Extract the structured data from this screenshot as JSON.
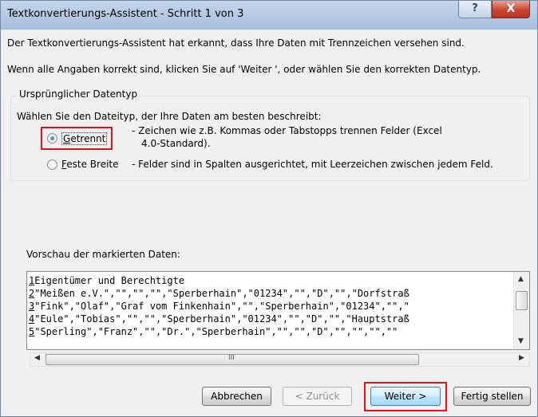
{
  "window": {
    "title": "Textkonvertierungs-Assistent - Schritt 1 von 3",
    "help_label": "?",
    "close_label": "X"
  },
  "info": {
    "line1": "Der Textkonvertierungs-Assistent hat erkannt, dass Ihre Daten mit Trennzeichen versehen sind.",
    "line2": "Wenn alle Angaben korrekt sind, klicken Sie auf 'Weiter ', oder wählen Sie den korrekten Datentyp."
  },
  "datatype_group": {
    "legend": "Ursprünglicher Datentyp",
    "prompt": "Wählen Sie den Dateityp, der Ihre Daten am besten beschreibt:",
    "options": [
      {
        "label": "Getrennt",
        "selected": true,
        "description_line1": "- Zeichen wie z.B. Kommas oder Tabstopps trennen Felder (Excel",
        "description_line2": "4.0-Standard)."
      },
      {
        "label": "Feste Breite",
        "selected": false,
        "description_line1": "- Felder sind in Spalten ausgerichtet, mit Leerzeichen zwischen jedem Feld."
      }
    ]
  },
  "preview": {
    "label": "Vorschau der markierten Daten:",
    "lines": [
      {
        "num": "1",
        "text": "Eigentümer und Berechtigte"
      },
      {
        "num": "2",
        "text": "\"Meißen e.V.\",\"\",\"\",\"\",\"Sperberhain\",\"01234\",\"\",\"D\",\"\",\"Dorfstraß"
      },
      {
        "num": "3",
        "text": "\"Fink\",\"Olaf\",\"Graf vom Finkenhain\",\"\",\"Sperberhain\",\"01234\",\"\",\""
      },
      {
        "num": "4",
        "text": "\"Eule\",\"Tobias\",\"\",\"\",\"Sperberhain\",\"01234\",\"\",\"D\",\"\",\"Hauptstraß"
      },
      {
        "num": "5",
        "text": "\"Sperling\",\"Franz\",\"\",\"Dr.\",\"Sperberhain\",\"\",\"\",\"D\",\"\",\"\",\"\",\"\""
      }
    ],
    "hscroll_grip": "III"
  },
  "buttons": {
    "cancel": "Abbrechen",
    "back": "< Zurück",
    "next": "Weiter >",
    "finish": "Fertig stellen"
  },
  "colors": {
    "highlight": "#e0111d",
    "titlebar": "#b2c7e1",
    "default_button": "#bee6fd"
  }
}
